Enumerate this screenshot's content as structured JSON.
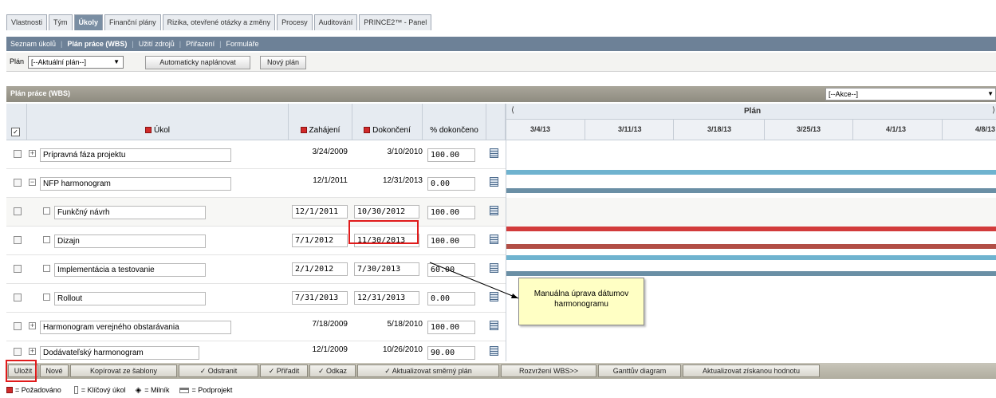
{
  "tabs": [
    "Vlastnosti",
    "Tým",
    "Úkoly",
    "Finanční plány",
    "Rizika, otevřené otázky a změny",
    "Procesy",
    "Auditování",
    "PRINCE2™ - Panel"
  ],
  "subnav": [
    "Seznam úkolů",
    "Plán práce (WBS)",
    "Užití zdrojů",
    "Přiřazení",
    "Formuláře"
  ],
  "plan_bar": {
    "label": "Plán",
    "select_value": "[--Aktuální plán--]",
    "auto_button": "Automaticky naplánovat",
    "new_button": "Nový plán"
  },
  "panel": {
    "title": "Plán práce (WBS)",
    "actions_select": "[--Akce--]"
  },
  "columns": {
    "task": "Úkol",
    "start": "Zahájení",
    "finish": "Dokončení",
    "pct": "% dokončeno"
  },
  "gantt": {
    "header": "Plán",
    "dates": [
      "3/4/13",
      "3/11/13",
      "3/18/13",
      "3/25/13",
      "4/1/13",
      "4/8/13"
    ]
  },
  "rows": [
    {
      "name": "Prípravná fáza projektu",
      "start": "3/24/2009",
      "finish": "3/10/2010",
      "pct": "100.00"
    },
    {
      "name": "NFP harmonogram",
      "start": "12/1/2011",
      "finish": "12/31/2013",
      "pct": "0.00"
    },
    {
      "name": "Funkčný návrh",
      "start": "12/1/2011",
      "finish": "10/30/2012",
      "pct": "100.00"
    },
    {
      "name": "Dizajn",
      "start": "7/1/2012",
      "finish": "11/30/2013",
      "pct": "100.00"
    },
    {
      "name": "Implementácia a testovanie",
      "start": "2/1/2012",
      "finish": "7/30/2013",
      "pct": "60.00"
    },
    {
      "name": "Rollout",
      "start": "7/31/2013",
      "finish": "12/31/2013",
      "pct": "0.00"
    },
    {
      "name": "Harmonogram verejného obstarávania",
      "start": "7/18/2009",
      "finish": "5/18/2010",
      "pct": "100.00"
    },
    {
      "name": "Dodávateľský harmonogram",
      "start": "12/1/2009",
      "finish": "10/26/2010",
      "pct": "90.00"
    }
  ],
  "callout": {
    "line1": "Manuálna úprava dátumov",
    "line2": "harmonogramu"
  },
  "bottom_buttons": [
    "Uložit",
    "Nové",
    "Kopírovat ze šablony",
    "✓ Odstranit",
    "✓ Přiřadit",
    "✓ Odkaz",
    "✓ Aktualizovat směrný plán",
    "Rozvržení WBS>>",
    "Ganttův diagram",
    "Aktualizovat získanou hodnotu"
  ],
  "legend": {
    "required": "= Požadováno",
    "key_task": "= Klíčový úkol",
    "milestone": "= Milník",
    "subproject": "= Podprojekt"
  },
  "colors": {
    "bar_blue": "#6fb3cf",
    "bar_slate": "#6a8fa5",
    "bar_red": "#d23b3b",
    "bar_brown": "#b24e46",
    "highlight": "#e01b1b"
  }
}
